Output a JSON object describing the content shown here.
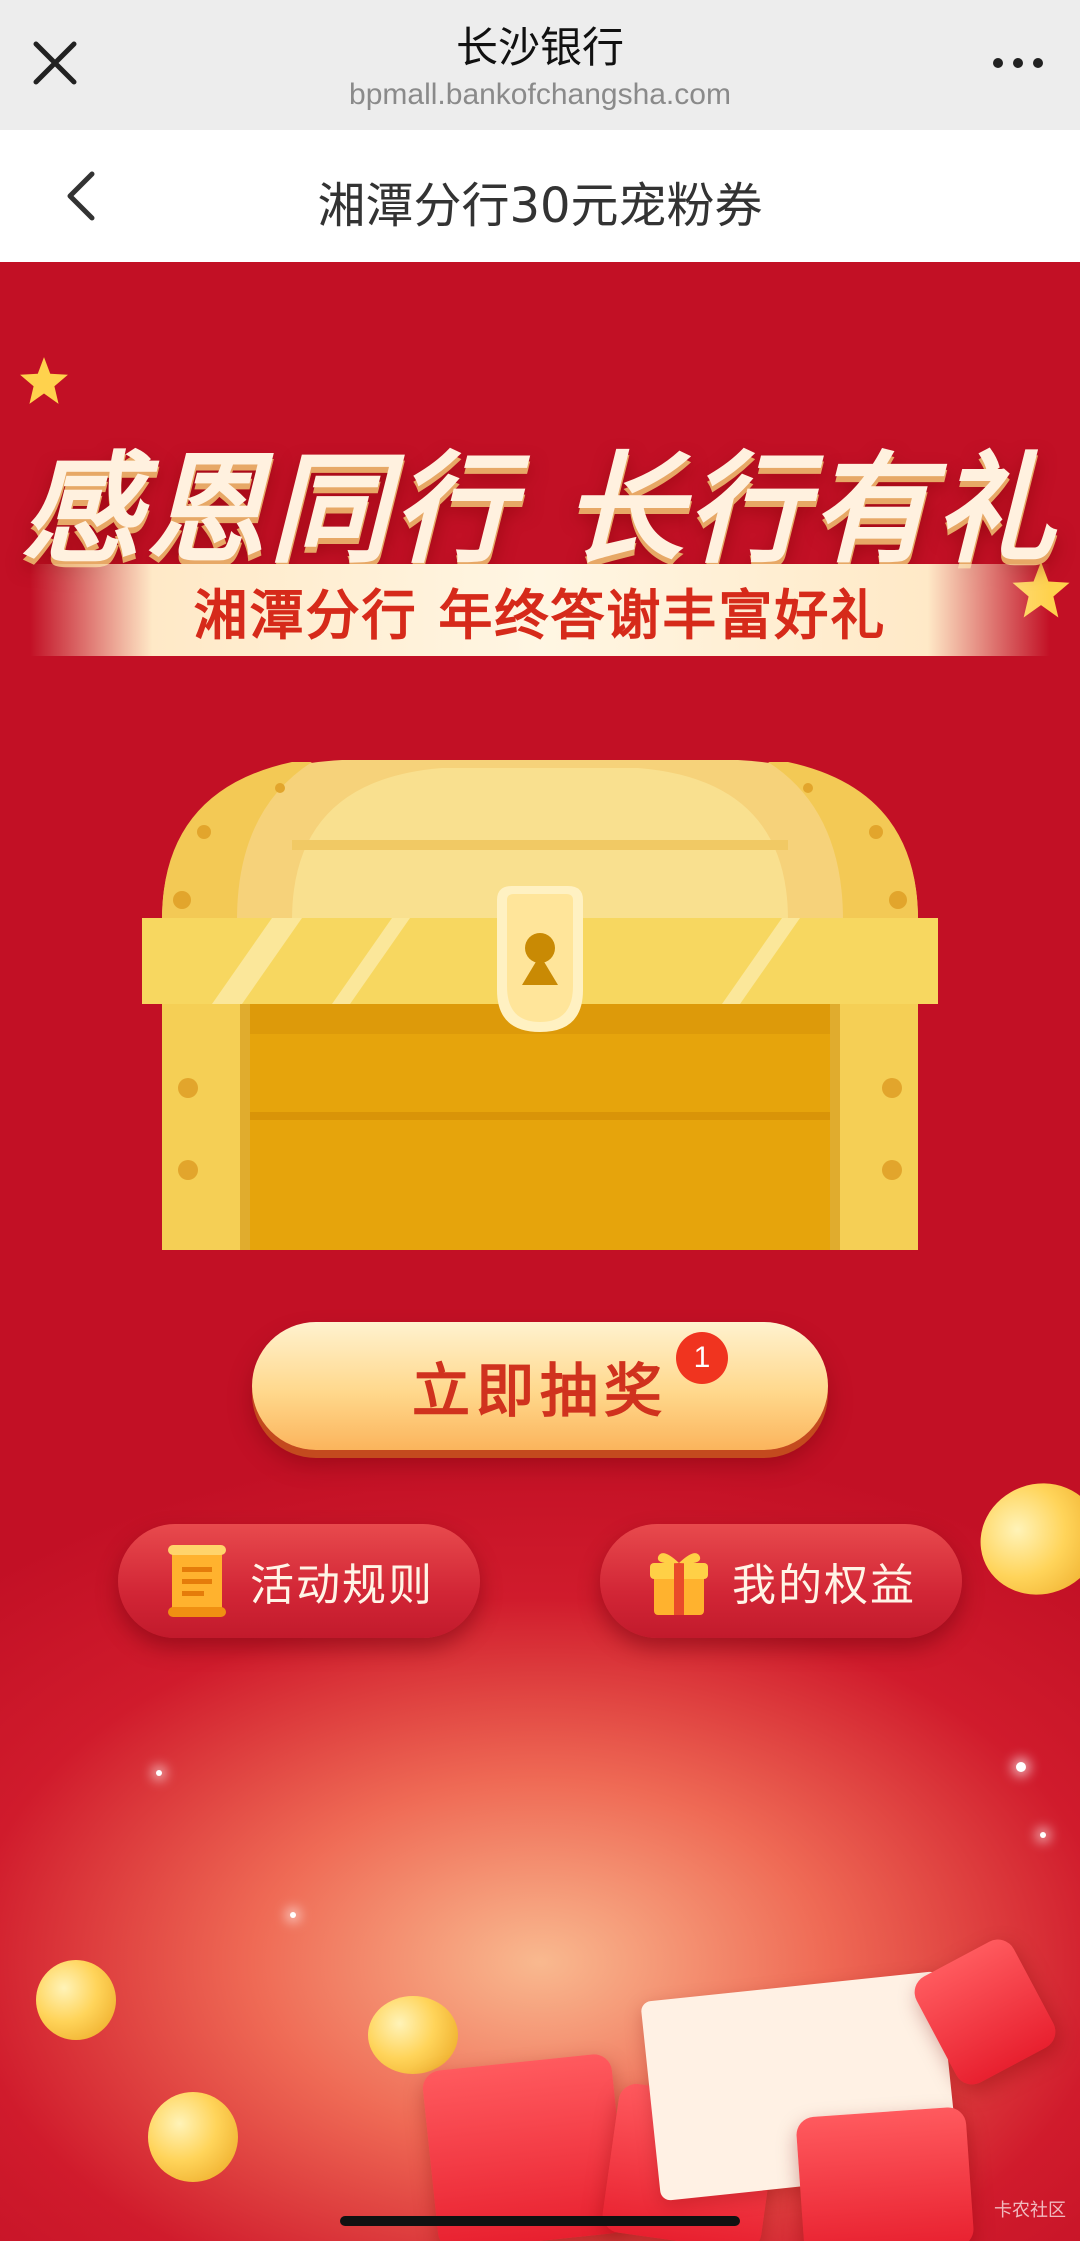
{
  "browser": {
    "site_name": "长沙银行",
    "url": "bpmall.bankofchangsha.com",
    "close_icon": "close-icon",
    "more_icon": "more-icon"
  },
  "nav": {
    "title": "湘潭分行30元宠粉券",
    "back_icon": "chevron-left-icon"
  },
  "banner": {
    "headline": "感恩同行 长行有礼",
    "subtitle": "湘潭分行 年终答谢丰富好礼"
  },
  "actions": {
    "draw_label": "立即抽奖",
    "draw_badge": "1",
    "rules_label": "活动规则",
    "mine_label": "我的权益"
  },
  "colors": {
    "background": "#c21025",
    "accent_gold": "#ffd88c",
    "button_text": "#d0321e"
  },
  "watermark": "卡农社区"
}
